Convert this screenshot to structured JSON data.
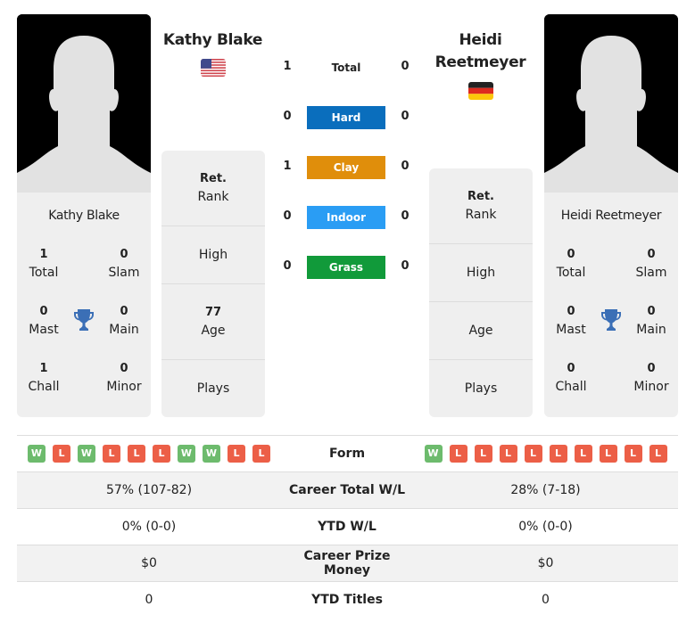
{
  "colors": {
    "hard": "#0a6ebd",
    "clay": "#e08e0b",
    "indoor": "#2a9df4",
    "grass": "#119a3a",
    "win": "#6dbb6d",
    "loss": "#ec5f47",
    "trophy": "#3b6fb6"
  },
  "player1": {
    "name": "Kathy Blake",
    "country_flag": "usa-flag-icon",
    "titles": {
      "total": {
        "value": "1",
        "label": "Total"
      },
      "slam": {
        "value": "0",
        "label": "Slam"
      },
      "mast": {
        "value": "0",
        "label": "Mast"
      },
      "main": {
        "value": "0",
        "label": "Main"
      },
      "chall": {
        "value": "1",
        "label": "Chall"
      },
      "minor": {
        "value": "0",
        "label": "Minor"
      }
    },
    "info": {
      "rank_value": "Ret.",
      "rank_label": "Rank",
      "high_label": "High",
      "age_value": "77",
      "age_label": "Age",
      "plays_label": "Plays"
    },
    "form": [
      "W",
      "L",
      "W",
      "L",
      "L",
      "L",
      "W",
      "W",
      "L",
      "L"
    ]
  },
  "player2": {
    "name_line1": "Heidi",
    "name_line2": "Reetmeyer",
    "name": "Heidi Reetmeyer",
    "country_flag": "germany-flag-icon",
    "titles": {
      "total": {
        "value": "0",
        "label": "Total"
      },
      "slam": {
        "value": "0",
        "label": "Slam"
      },
      "mast": {
        "value": "0",
        "label": "Mast"
      },
      "main": {
        "value": "0",
        "label": "Main"
      },
      "chall": {
        "value": "0",
        "label": "Chall"
      },
      "minor": {
        "value": "0",
        "label": "Minor"
      }
    },
    "info": {
      "rank_value": "Ret.",
      "rank_label": "Rank",
      "high_label": "High",
      "age_label": "Age",
      "plays_label": "Plays"
    },
    "form": [
      "W",
      "L",
      "L",
      "L",
      "L",
      "L",
      "L",
      "L",
      "L",
      "L"
    ]
  },
  "h2h": [
    {
      "label": "Total",
      "p1": "1",
      "p2": "0",
      "type": "total"
    },
    {
      "label": "Hard",
      "p1": "0",
      "p2": "0",
      "type": "hard"
    },
    {
      "label": "Clay",
      "p1": "1",
      "p2": "0",
      "type": "clay"
    },
    {
      "label": "Indoor",
      "p1": "0",
      "p2": "0",
      "type": "indoor"
    },
    {
      "label": "Grass",
      "p1": "0",
      "p2": "0",
      "type": "grass"
    }
  ],
  "stats": {
    "form_label": "Form",
    "rows": [
      {
        "label": "Career Total W/L",
        "p1": "57% (107-82)",
        "p2": "28% (7-18)"
      },
      {
        "label": "YTD W/L",
        "p1": "0% (0-0)",
        "p2": "0% (0-0)"
      },
      {
        "label": "Career Prize Money",
        "p1": "$0",
        "p2": "$0"
      },
      {
        "label": "YTD Titles",
        "p1": "0",
        "p2": "0"
      }
    ]
  }
}
